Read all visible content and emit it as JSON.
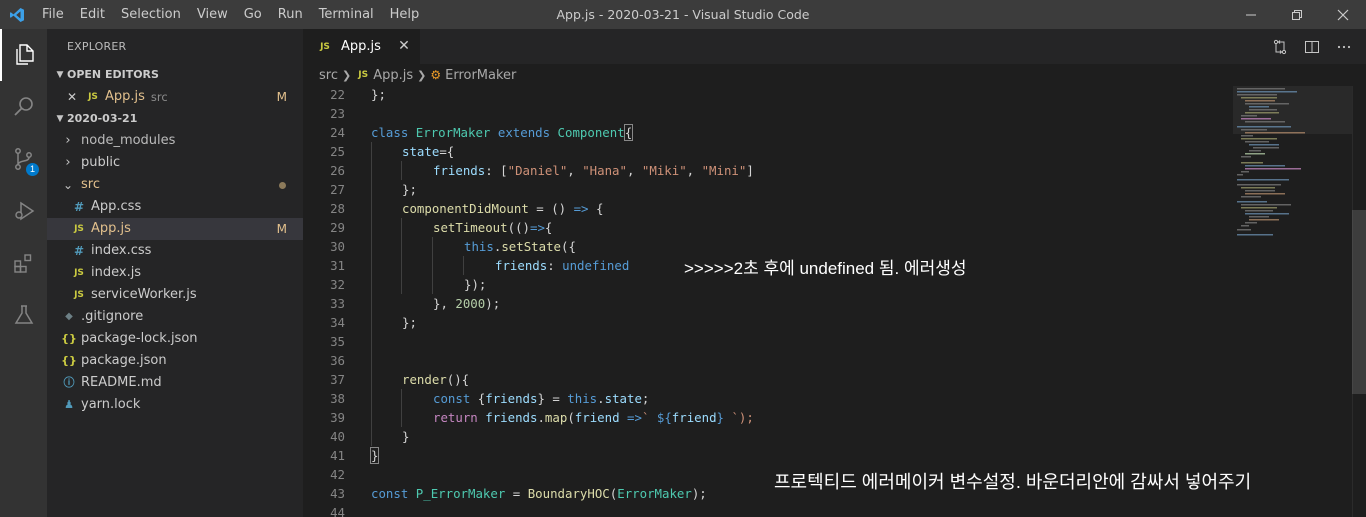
{
  "window": {
    "title": "App.js - 2020-03-21 - Visual Studio Code",
    "menu": [
      "File",
      "Edit",
      "Selection",
      "View",
      "Go",
      "Run",
      "Terminal",
      "Help"
    ]
  },
  "activity_bar": {
    "items": [
      "explorer",
      "search",
      "source-control",
      "run-debug",
      "extensions",
      "testing"
    ],
    "scm_badge": "1"
  },
  "sidebar": {
    "title": "EXPLORER",
    "open_editors": {
      "header": "OPEN EDITORS",
      "items": [
        {
          "close": "✕",
          "icon": "JS",
          "name": "App.js",
          "desc": "src",
          "status": "M"
        }
      ]
    },
    "folder": {
      "header": "2020-03-21",
      "items": [
        {
          "name": "node_modules",
          "type": "folder",
          "chevron": "›"
        },
        {
          "name": "public",
          "type": "folder",
          "chevron": "›"
        },
        {
          "name": "src",
          "type": "folder",
          "chevron": "⌄"
        },
        {
          "name": "App.css",
          "type": "css",
          "icon": "#"
        },
        {
          "name": "App.js",
          "type": "js",
          "icon": "JS",
          "status": "M"
        },
        {
          "name": "index.css",
          "type": "css",
          "icon": "#"
        },
        {
          "name": "index.js",
          "type": "js",
          "icon": "JS"
        },
        {
          "name": "serviceWorker.js",
          "type": "js",
          "icon": "JS"
        },
        {
          "name": ".gitignore",
          "type": "git",
          "icon": "◆"
        },
        {
          "name": "package-lock.json",
          "type": "json",
          "icon": "{}"
        },
        {
          "name": "package.json",
          "type": "json",
          "icon": "{}"
        },
        {
          "name": "README.md",
          "type": "info",
          "icon": "ⓘ"
        },
        {
          "name": "yarn.lock",
          "type": "yarn",
          "icon": "♟"
        }
      ]
    }
  },
  "tabs": [
    {
      "icon": "JS",
      "label": "App.js",
      "close": "✕"
    }
  ],
  "breadcrumb": [
    "src",
    "App.js",
    "ErrorMaker"
  ],
  "editor": {
    "line_numbers": [
      "22",
      "23",
      "24",
      "25",
      "26",
      "27",
      "28",
      "29",
      "30",
      "31",
      "32",
      "33",
      "34",
      "35",
      "36",
      "37",
      "38",
      "39",
      "40",
      "41",
      "42",
      "43",
      "44"
    ],
    "lines": {
      "l22": [
        "};"
      ],
      "l24": [
        "class",
        " ",
        "ErrorMaker",
        " ",
        "extends",
        " ",
        "Component",
        "{"
      ],
      "l25": [
        "state",
        "={"
      ],
      "l26": [
        "friends",
        ": [",
        "\"Daniel\"",
        ", ",
        "\"Hana\"",
        ", ",
        "\"Miki\"",
        ", ",
        "\"Mini\"",
        "]"
      ],
      "l27": [
        "};"
      ],
      "l28": [
        "componentDidMount",
        " = () ",
        "=>",
        " {"
      ],
      "l29": [
        "setTimeout",
        "(()",
        "=>",
        "{"
      ],
      "l30": [
        "this",
        ".",
        "setState",
        "({"
      ],
      "l31": [
        "friends",
        ": ",
        "undefined"
      ],
      "l32": [
        "});"
      ],
      "l33": [
        "}, ",
        "2000",
        ");"
      ],
      "l34": [
        "};"
      ],
      "l37": [
        "render",
        "(){"
      ],
      "l38": [
        "const",
        " {",
        "friends",
        "} = ",
        "this",
        ".",
        "state",
        ";"
      ],
      "l39": [
        "return",
        " ",
        "friends",
        ".",
        "map",
        "(",
        "friend",
        " ",
        "=>",
        "` ",
        "${",
        "friend",
        "}",
        " `);"
      ],
      "l40": [
        "}"
      ],
      "l41": [
        "}"
      ],
      "l43": [
        "const",
        " ",
        "P_ErrorMaker",
        " = ",
        "BoundaryHOC",
        "(",
        "ErrorMaker",
        ");"
      ]
    },
    "annotations": {
      "note1": ">>>>>2초 후에 undefined 됨. 에러생성",
      "note2": "프로텍티드 에러메이커 변수설정. 바운더리안에 감싸서 넣어주기"
    }
  },
  "colors": {
    "titlebar": "#3c3c3c",
    "activitybar": "#333333",
    "sidebar": "#252526",
    "editor": "#1e1e1e",
    "accent": "#007acc",
    "modified": "#e2c08d"
  }
}
